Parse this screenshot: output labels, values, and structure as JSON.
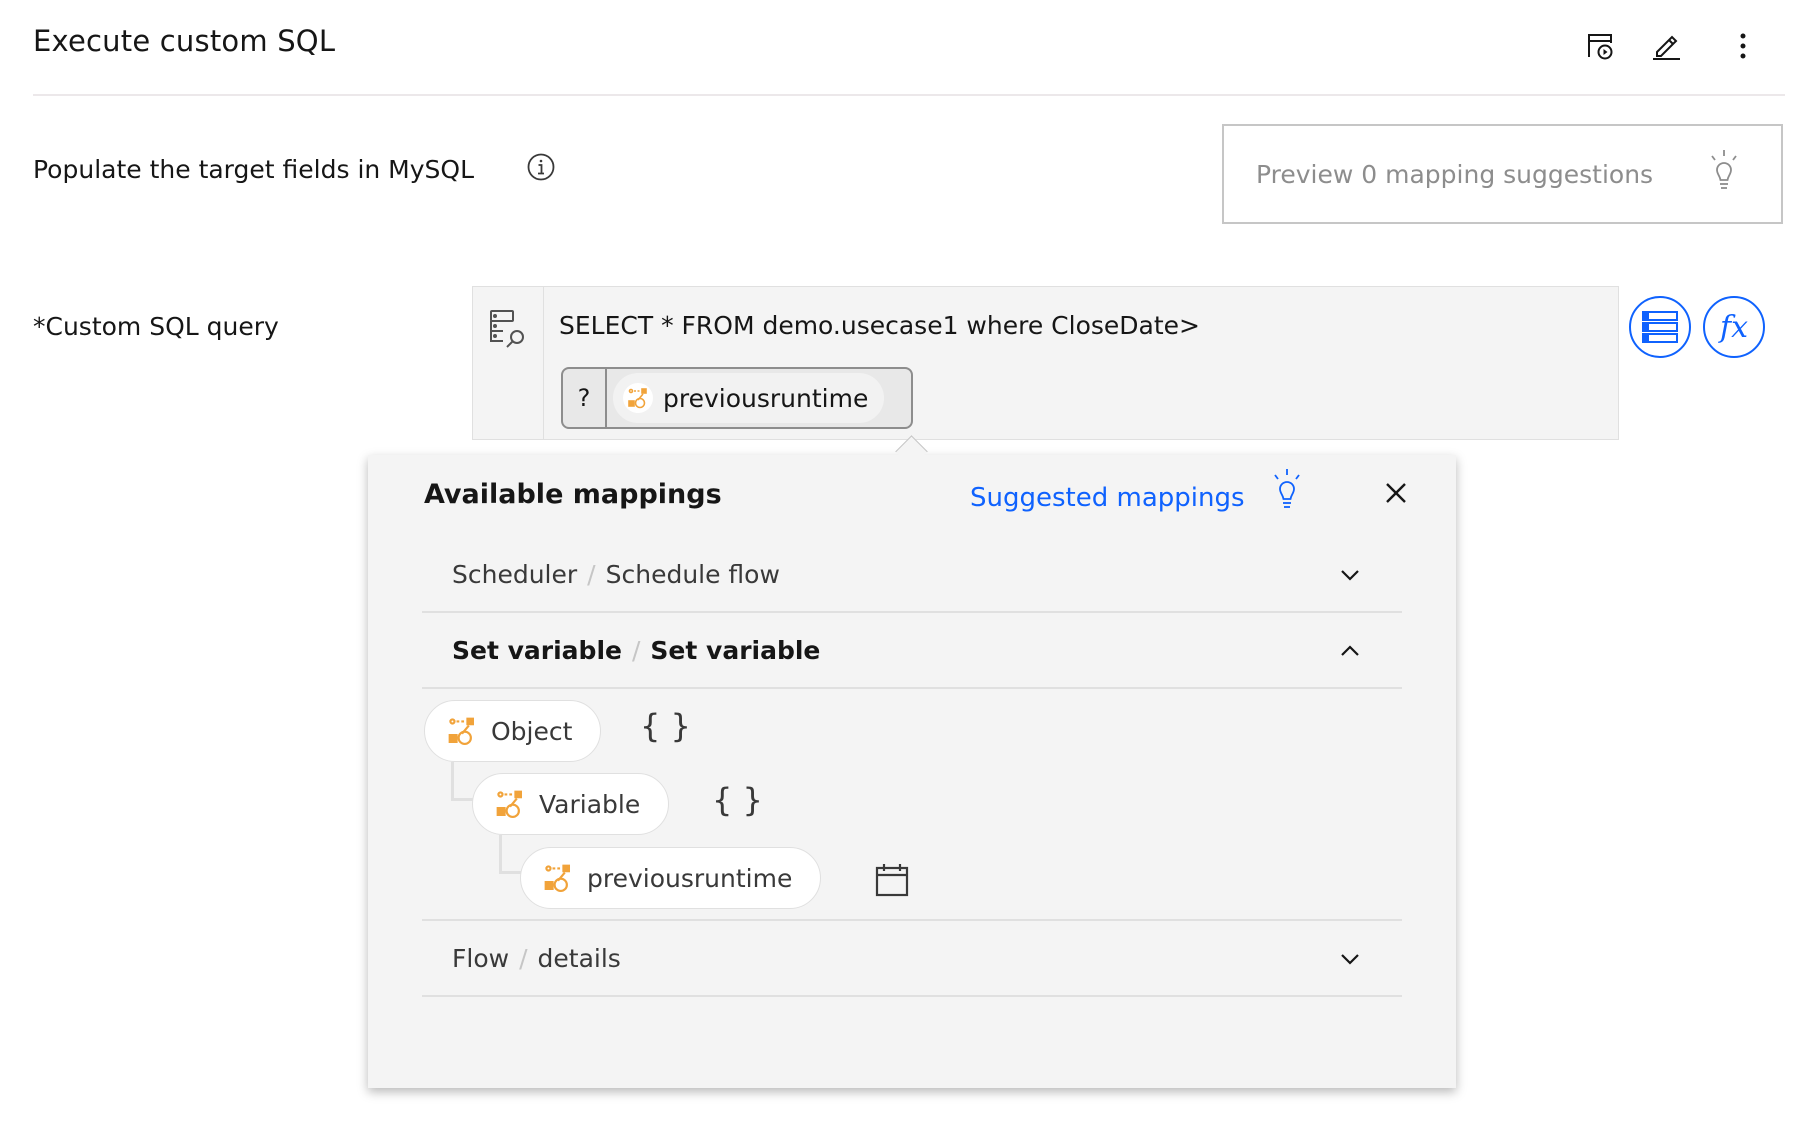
{
  "header": {
    "title": "Execute custom SQL",
    "icons": [
      "run-schedule-icon",
      "edit-icon",
      "overflow-menu-icon"
    ]
  },
  "populate": {
    "label": "Populate the target fields in MySQL",
    "info_icon": "information-icon"
  },
  "preview": {
    "label": "Preview 0 mapping suggestions",
    "icon": "lightbulb-icon"
  },
  "sql": {
    "label": "*Custom SQL query",
    "query_text": "SELECT * FROM demo.usecase1 where CloseDate>",
    "chip_prefix": "?",
    "chip_label": "previousruntime",
    "buttons": [
      "data-mapping-icon",
      "function-icon"
    ]
  },
  "popup": {
    "title": "Available mappings",
    "suggested_label": "Suggested mappings",
    "colors": {
      "accent": "#0f62fe",
      "node_icon": "#f1a33a"
    },
    "sections": [
      {
        "parent": "Scheduler",
        "child": "Schedule flow",
        "expanded": false
      },
      {
        "parent": "Set variable",
        "child": "Set variable",
        "expanded": true
      },
      {
        "parent": "Flow",
        "child": "details",
        "expanded": false
      }
    ],
    "tree": [
      {
        "label": "Object",
        "type_icon": "{ }"
      },
      {
        "label": "Variable",
        "type_icon": "{ }"
      },
      {
        "label": "previousruntime",
        "type_icon": "calendar-icon"
      }
    ]
  }
}
